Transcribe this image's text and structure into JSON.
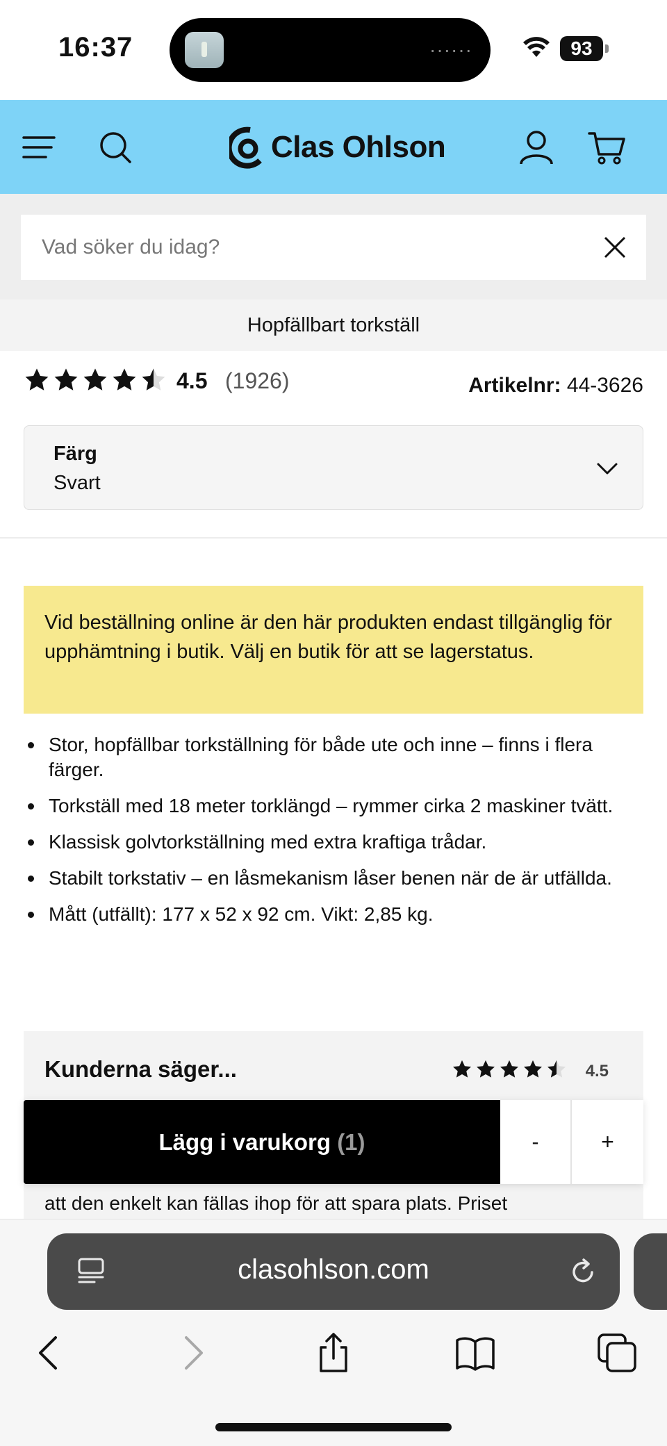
{
  "status_bar": {
    "time": "16:37",
    "battery": "93"
  },
  "header": {
    "brand": "Clas Ohlson"
  },
  "search": {
    "placeholder": "Vad söker du idag?"
  },
  "product": {
    "title": "Hopfällbart torkställ",
    "rating_value": "4.5",
    "rating_count": "(1926)",
    "article_label": "Artikelnr:",
    "article_number": "44-3626",
    "color_label": "Färg",
    "color_value": "Svart"
  },
  "notice": "Vid beställning online är den här produkten endast tillgänglig för upphämtning i butik. Välj en butik för att se lagerstatus.",
  "bullets": [
    "Stor, hopfällbar torkställning för både ute och inne – finns i flera färger.",
    "Torkställ med 18 meter torklängd – rymmer cirka 2 maskiner tvätt.",
    "Klassisk golvtorkställning med extra kraftiga trådar.",
    "Stabilt torkstativ – en låsmekanism låser benen när de är utfällda.",
    "Mått (utfällt): 177 x 52 x 92 cm. Vikt: 2,85 kg."
  ],
  "reviews": {
    "title": "Kunderna säger...",
    "score": "4.5",
    "snippet": "att den enkelt kan fällas ihop för att spara plats. Priset"
  },
  "cart": {
    "add_label": "Lägg i varukorg",
    "quantity": "(1)",
    "minus": "-",
    "plus": "+"
  },
  "browser": {
    "url": "clasohlson.com"
  },
  "colors": {
    "header_bg": "#7ed3f7",
    "notice_bg": "#f7e98f",
    "cart_button": "#000000"
  },
  "icons": [
    "menu-icon",
    "search-icon",
    "user-icon",
    "cart-icon",
    "close-icon",
    "chevron-down-icon",
    "star-icon",
    "tabs-icon",
    "reload-icon",
    "back-icon",
    "forward-icon",
    "share-icon",
    "bookmarks-icon",
    "tabs-overview-icon"
  ]
}
